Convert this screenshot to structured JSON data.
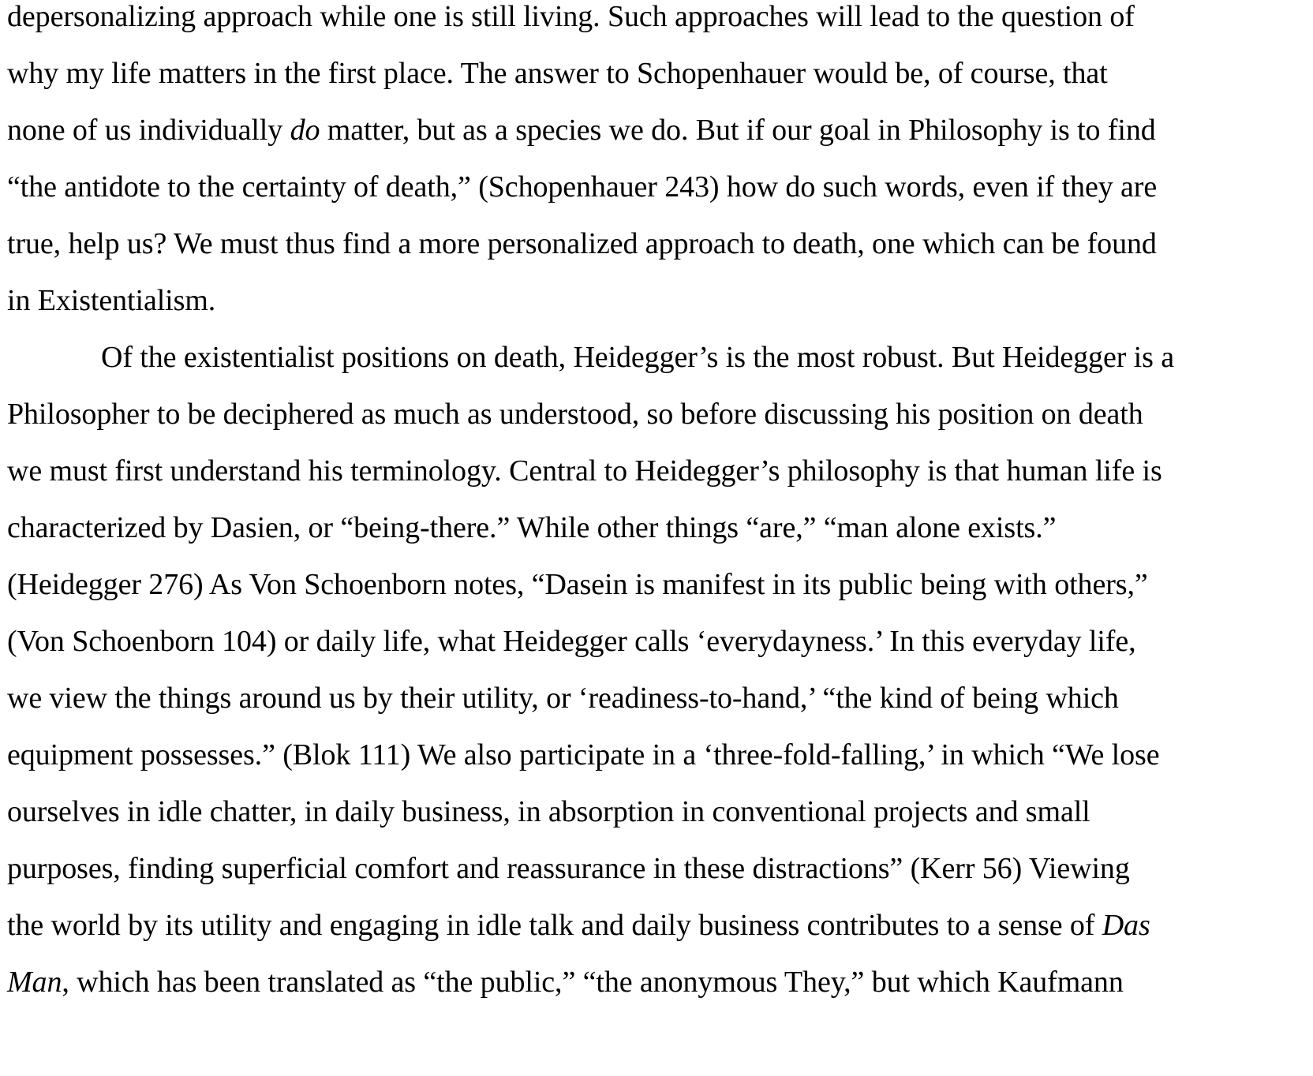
{
  "document": {
    "lines": [
      [
        {
          "t": "depersonalizing approach while one is still living. Such approaches will lead to the question of"
        }
      ],
      [
        {
          "t": "why my life matters in the first place. The answer to Schopenhauer would be, of course, that"
        }
      ],
      [
        {
          "t": "none of us individually "
        },
        {
          "t": "do",
          "i": true
        },
        {
          "t": " matter, but as a species we do. But if our goal in Philosophy is to find"
        }
      ],
      [
        {
          "t": "“the antidote to the certainty of death,” (Schopenhauer 243) how do such words, even if they are"
        }
      ],
      [
        {
          "t": "true, help us? We must thus find a more personalized approach to death, one which can be found"
        }
      ],
      [
        {
          "t": "in Existentialism."
        }
      ],
      [
        {
          "t": "Of the existentialist positions on death, Heidegger’s is the most robust. But Heidegger is a"
        }
      ],
      [
        {
          "t": "Philosopher to be deciphered as much as understood, so before discussing his position on death"
        }
      ],
      [
        {
          "t": "we must first understand his terminology. Central to Heidegger’s philosophy is that human life is"
        }
      ],
      [
        {
          "t": "characterized by Dasien, or “being-there.” While other things “are,” “man alone exists.”"
        }
      ],
      [
        {
          "t": "(Heidegger 276) As Von Schoenborn notes, “Dasein is manifest in its public being with others,”"
        }
      ],
      [
        {
          "t": "(Von Schoenborn 104) or daily life, what Heidegger calls ‘everydayness.’ In this everyday life,"
        }
      ],
      [
        {
          "t": "we view the things around us by their utility, or ‘readiness-to-hand,’ “the kind of being which"
        }
      ],
      [
        {
          "t": "equipment possesses.” (Blok 111) We also participate in a ‘three-fold-falling,’ in which “We lose"
        }
      ],
      [
        {
          "t": "ourselves in idle chatter, in daily business, in absorption in conventional projects and small"
        }
      ],
      [
        {
          "t": "purposes, finding superficial comfort and reassurance in these distractions” (Kerr 56) Viewing"
        }
      ],
      [
        {
          "t": "the world by its utility and engaging in idle talk and daily business contributes to a sense of "
        },
        {
          "t": "Das",
          "i": true
        }
      ],
      [
        {
          "t": "Man",
          "i": true
        },
        {
          "t": ", which has been translated as “the public,” “the anonymous They,” but which Kaufmann"
        }
      ]
    ]
  }
}
